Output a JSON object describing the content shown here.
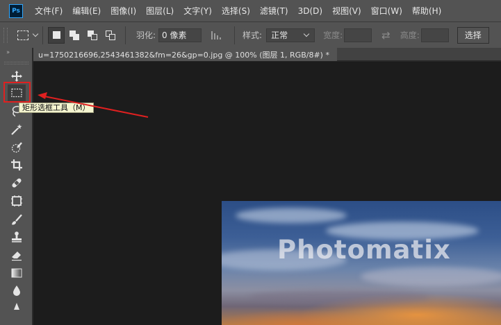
{
  "app": {
    "logo_text": "Ps",
    "menu": [
      "文件(F)",
      "编辑(E)",
      "图像(I)",
      "图层(L)",
      "文字(Y)",
      "选择(S)",
      "滤镜(T)",
      "3D(D)",
      "视图(V)",
      "窗口(W)",
      "帮助(H)"
    ]
  },
  "options_bar": {
    "feather_label": "羽化:",
    "feather_value": "0 像素",
    "style_label": "样式:",
    "style_value": "正常",
    "width_label": "宽度:",
    "width_value": "",
    "height_label": "高度:",
    "height_value": "",
    "select_button_label": "选择"
  },
  "document": {
    "tab_title": "u=1750216696,2543461382&fm=26&gp=0.jpg @ 100% (图层 1, RGB/8#) *",
    "close_glyph": "×",
    "watermark_text": "Photomatix"
  },
  "toolbar": {
    "collapse_glyph": "››",
    "tools": [
      {
        "name": "move-tool",
        "icon": "move-icon"
      },
      {
        "name": "rectangular-marquee-tool",
        "icon": "rectangular-marquee-icon",
        "selected": true
      },
      {
        "name": "lasso-tool",
        "icon": "lasso-icon"
      },
      {
        "name": "magic-wand-tool",
        "icon": "magic-wand-icon"
      },
      {
        "name": "quick-selection-tool",
        "icon": "quick-selection-icon"
      },
      {
        "name": "crop-tool",
        "icon": "crop-icon"
      },
      {
        "name": "healing-brush-tool",
        "icon": "bandage-icon"
      },
      {
        "name": "frame-tool",
        "icon": "frame-icon"
      },
      {
        "name": "brush-tool",
        "icon": "brush-icon"
      },
      {
        "name": "clone-stamp-tool",
        "icon": "stamp-icon"
      },
      {
        "name": "eraser-tool",
        "icon": "eraser-icon"
      },
      {
        "name": "gradient-tool",
        "icon": "gradient-icon"
      },
      {
        "name": "blur-tool",
        "icon": "drop-icon"
      }
    ]
  },
  "tooltip": {
    "text": "矩形选框工具（M）"
  },
  "colors": {
    "panel": "#535353",
    "canvas_bg": "#1c1c1c",
    "annotation_red": "#e02020",
    "tooltip_bg": "#f5f5d0"
  }
}
